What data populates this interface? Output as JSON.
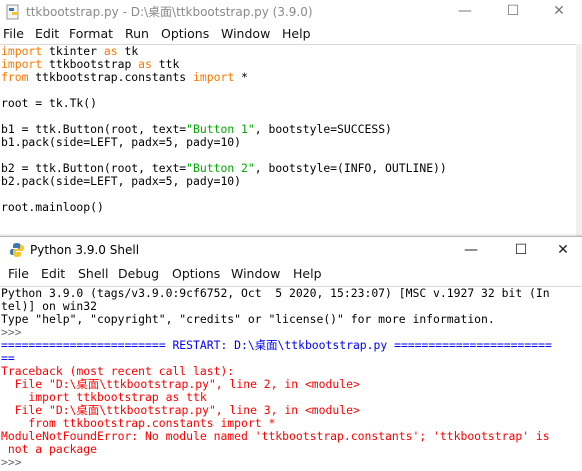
{
  "editor": {
    "title": "ttkbootstrap.py - D:\\桌面\\ttkbootstrap.py (3.9.0)",
    "menu": [
      "File",
      "Edit",
      "Format",
      "Run",
      "Options",
      "Window",
      "Help"
    ],
    "code": {
      "l1_kw": "import",
      "l1_a": " tkinter ",
      "l1_kw2": "as",
      "l1_b": " tk",
      "l2_kw": "import",
      "l2_a": " ttkbootstrap ",
      "l2_kw2": "as",
      "l2_b": " ttk",
      "l3_kw": "from",
      "l3_a": " ttkbootstrap.constants ",
      "l3_kw2": "import",
      "l3_b": " *",
      "l5": "root = tk.Tk()",
      "l7_a": "b1 = ttk.Button(root, text=",
      "l7_str": "\"Button 1\"",
      "l7_b": ", bootstyle=SUCCESS)",
      "l8": "b1.pack(side=LEFT, padx=5, pady=10)",
      "l10_a": "b2 = ttk.Button(root, text=",
      "l10_str": "\"Button 2\"",
      "l10_b": ", bootstyle=(INFO, OUTLINE))",
      "l11": "b2.pack(side=LEFT, padx=5, pady=10)",
      "l13": "root.mainloop()"
    }
  },
  "shell": {
    "title": "Python 3.9.0 Shell",
    "menu": [
      "File",
      "Edit",
      "Shell",
      "Debug",
      "Options",
      "Window",
      "Help"
    ],
    "output": {
      "o1": "Python 3.9.0 (tags/v3.9.0:9cf6752, Oct  5 2020, 15:23:07) [MSC v.1927 32 bit (In",
      "o2": "tel)] on win32",
      "o3": "Type \"help\", \"copyright\", \"credits\" or \"license()\" for more information.",
      "o4": ">>> ",
      "o5": "======================== RESTART: D:\\桌面\\ttkbootstrap.py =======================",
      "o6": "==",
      "o7": "Traceback (most recent call last):",
      "o8": "  File \"D:\\桌面\\ttkbootstrap.py\", line 2, in <module>",
      "o9": "    import ttkbootstrap as ttk",
      "o10": "  File \"D:\\桌面\\ttkbootstrap.py\", line 3, in <module>",
      "o11": "    from ttkbootstrap.constants import *",
      "o12": "ModuleNotFoundError: No module named 'ttkbootstrap.constants'; 'ttkbootstrap' is",
      "o13": " not a package",
      "o14": ">>> "
    }
  },
  "window_controls": {
    "minimize": "—",
    "maximize": "☐",
    "close": "✕"
  }
}
